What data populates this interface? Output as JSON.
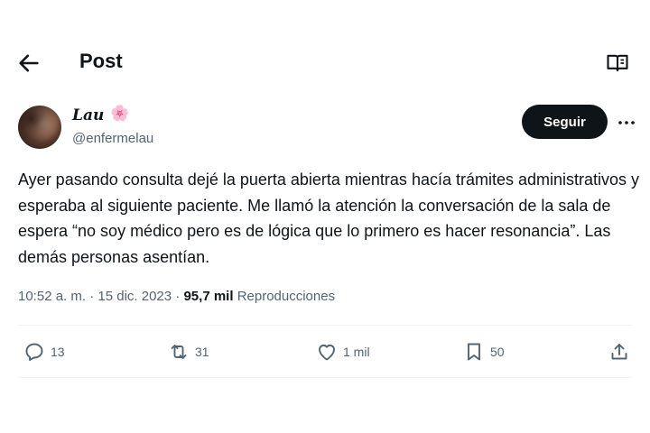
{
  "header": {
    "title": "Post",
    "back_icon": "arrow-left-icon",
    "reader_icon": "book-icon"
  },
  "author": {
    "display_name": "Lau",
    "emoji": "🌸",
    "handle": "@enfermelau",
    "follow_label": "Seguir"
  },
  "tweet": {
    "text": "Ayer pasando consulta dejé la puerta abierta mientras hacía trámites administrativos y esperaba al siguiente paciente. Me llamó la atención la conversación de la sala de espera “no soy médico pero es de lógica que lo primero es hacer resonancia”. Las demás personas asentían.",
    "time": "10:52 a. m.",
    "date": "15 dic. 2023",
    "views_count": "95,7 mil",
    "views_label": "Reproducciones"
  },
  "actions": {
    "replies": "13",
    "reposts": "31",
    "likes": "1 mil",
    "bookmarks": "50"
  },
  "colors": {
    "text": "#0f1419",
    "muted": "#536471",
    "button": "#0f1419"
  }
}
